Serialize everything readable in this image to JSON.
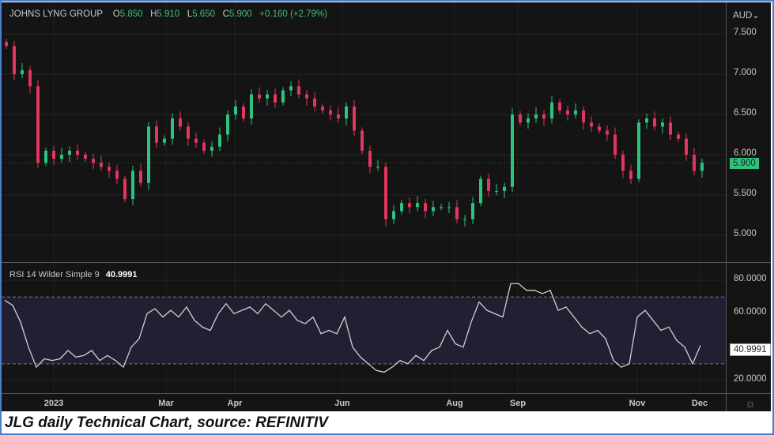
{
  "header": {
    "symbol": "JOHNS LYNG GROUP",
    "o_label": "O",
    "open": "5.850",
    "h_label": "H",
    "high": "5.910",
    "l_label": "L",
    "low": "5.650",
    "c_label": "C",
    "close": "5.900",
    "change": "+0.160 (+2.79%)"
  },
  "currency": "AUD",
  "rsi": {
    "label": "RSI 14 Wilder Simple 9",
    "value": "40.9991"
  },
  "caption": "JLG daily Technical Chart, source: REFINITIV",
  "colors": {
    "up": "#2fc27c",
    "down": "#e2365c",
    "background": "#141414",
    "rsi_band": "#221f33",
    "rsi_line": "#d0d0d0"
  },
  "chart_data": [
    {
      "type": "candlestick",
      "title": "JOHNS LYNG GROUP",
      "ylabel": "AUD",
      "ylim": [
        4.7,
        7.85
      ],
      "y_ticks": [
        "7.500",
        "7.000",
        "6.500",
        "6.000",
        "5.500",
        "5.000"
      ],
      "x_ticks": [
        "2023",
        "Mar",
        "Apr",
        "Jun",
        "Aug",
        "Sep",
        "Nov",
        "Dec"
      ],
      "last_price": "5.900",
      "closes": [
        7.35,
        7.0,
        7.05,
        6.85,
        5.9,
        6.05,
        5.95,
        6.0,
        6.05,
        6.0,
        5.95,
        5.9,
        5.85,
        5.8,
        5.7,
        5.45,
        5.8,
        5.65,
        6.35,
        6.15,
        6.2,
        6.45,
        6.35,
        6.2,
        6.15,
        6.05,
        6.1,
        6.25,
        6.5,
        6.6,
        6.45,
        6.75,
        6.7,
        6.75,
        6.65,
        6.8,
        6.85,
        6.75,
        6.7,
        6.6,
        6.55,
        6.5,
        6.45,
        6.6,
        6.3,
        6.05,
        5.85,
        5.85,
        5.2,
        5.3,
        5.4,
        5.35,
        5.4,
        5.3,
        5.35,
        5.35,
        5.35,
        5.2,
        5.2,
        5.4,
        5.7,
        5.55,
        5.55,
        5.6,
        6.5,
        6.4,
        6.45,
        6.5,
        6.45,
        6.65,
        6.55,
        6.5,
        6.55,
        6.4,
        6.35,
        6.3,
        6.25,
        6.0,
        5.8,
        5.7,
        6.4,
        6.45,
        6.35,
        6.4,
        6.25,
        6.2,
        6.0,
        5.8,
        5.9
      ]
    },
    {
      "type": "line",
      "title": "RSI 14 Wilder Simple 9",
      "ylim": [
        10,
        88
      ],
      "y_ticks": [
        "80.0000",
        "60.0000",
        "20.0000"
      ],
      "bands": [
        30,
        70
      ],
      "last_value": "40.9991",
      "values": [
        68,
        65,
        55,
        40,
        28,
        33,
        32,
        33,
        38,
        34,
        35,
        38,
        32,
        35,
        32,
        28,
        40,
        45,
        60,
        63,
        58,
        62,
        58,
        64,
        56,
        52,
        50,
        60,
        66,
        60,
        62,
        64,
        60,
        66,
        62,
        58,
        62,
        56,
        54,
        58,
        48,
        50,
        48,
        58,
        40,
        34,
        30,
        26,
        25,
        28,
        32,
        30,
        35,
        32,
        38,
        40,
        50,
        42,
        40,
        55,
        67,
        62,
        60,
        58,
        78,
        78,
        74,
        74,
        72,
        74,
        62,
        64,
        58,
        52,
        48,
        50,
        45,
        32,
        28,
        30,
        58,
        62,
        56,
        50,
        52,
        44,
        40,
        30,
        41
      ]
    }
  ]
}
